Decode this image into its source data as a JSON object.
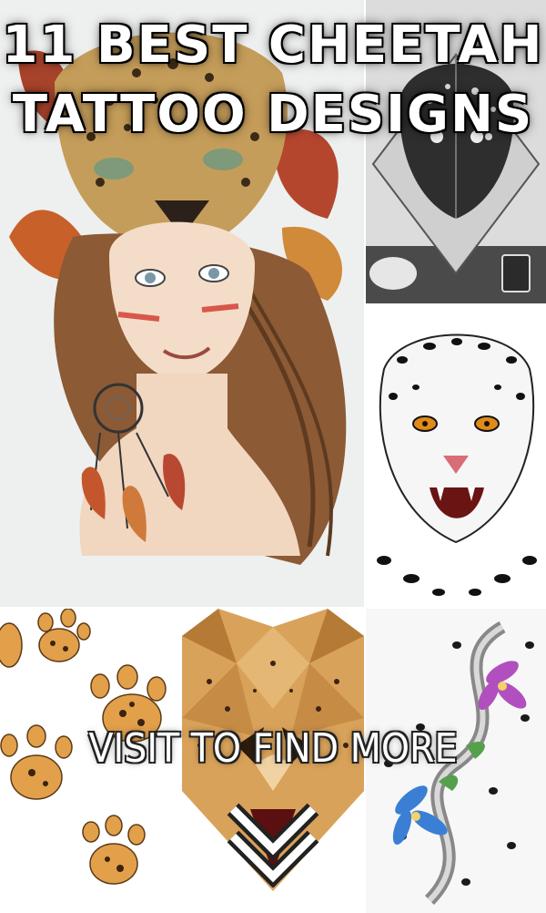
{
  "title": {
    "line1": "11 BEST CHEETAH",
    "line2": "TATTOO DESIGNS"
  },
  "cta": {
    "label": "VISIT TO FIND MORE"
  },
  "icons": {
    "scroll": "chevron-down-icon"
  },
  "colors": {
    "text": "#ffffff",
    "background": "#ffffff"
  }
}
